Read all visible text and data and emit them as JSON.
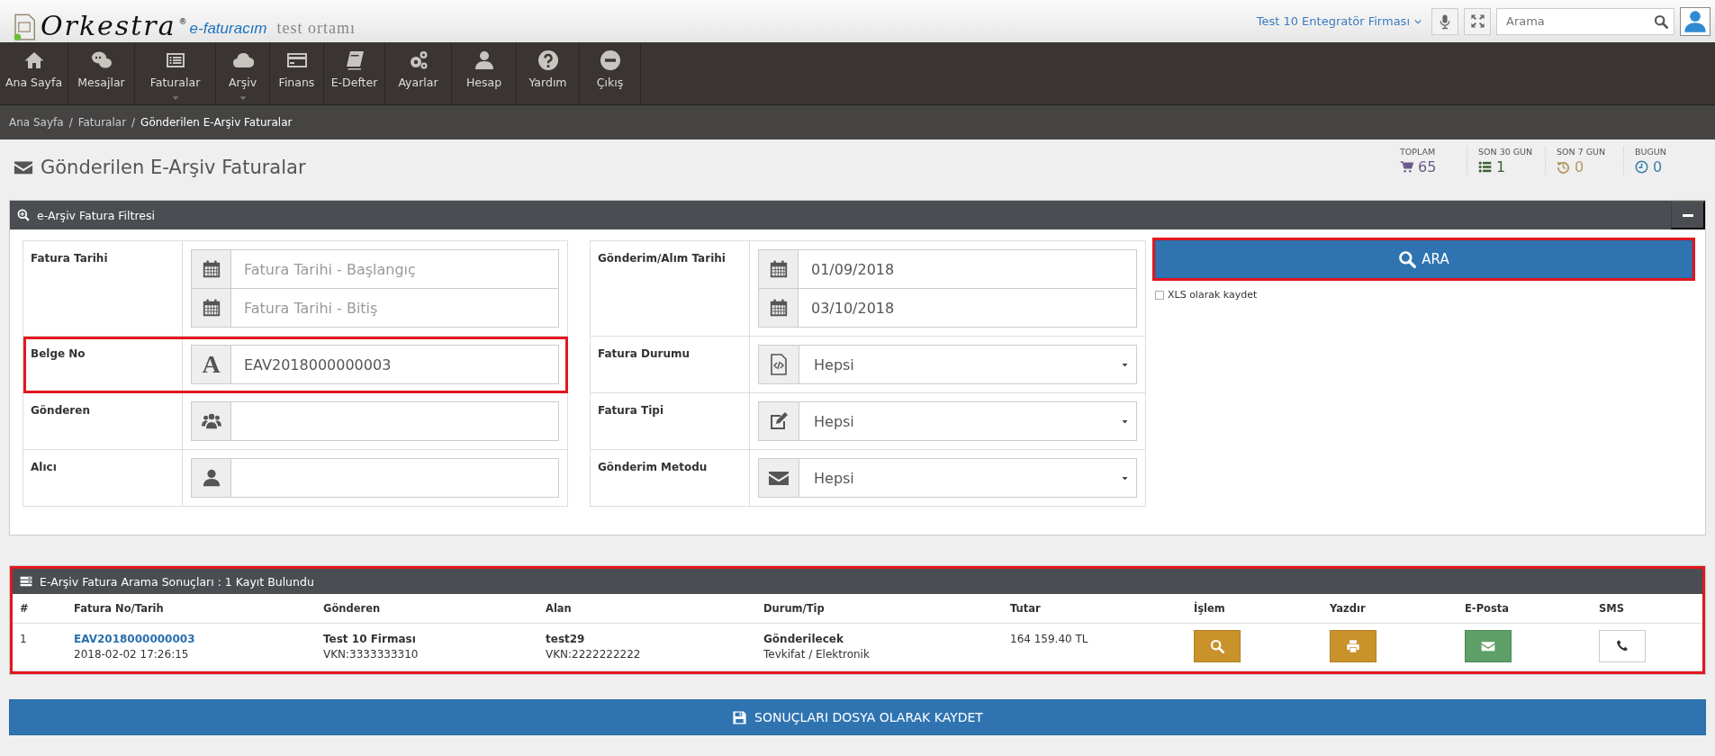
{
  "header": {
    "logo": {
      "brand": "Orkestra",
      "registered": "®",
      "product": "e-faturacım",
      "environment": "test ortamı"
    },
    "company": "Test 10 Entegratör Firması",
    "search": {
      "placeholder": "Arama"
    }
  },
  "nav": [
    {
      "label": "Ana Sayfa",
      "has_submenu": false
    },
    {
      "label": "Mesajlar",
      "has_submenu": false
    },
    {
      "label": "Faturalar",
      "has_submenu": true
    },
    {
      "label": "Arşiv",
      "has_submenu": true
    },
    {
      "label": "Finans",
      "has_submenu": false
    },
    {
      "label": "E-Defter",
      "has_submenu": false
    },
    {
      "label": "Ayarlar",
      "has_submenu": false
    },
    {
      "label": "Hesap",
      "has_submenu": false
    },
    {
      "label": "Yardım",
      "has_submenu": false
    },
    {
      "label": "Çıkış",
      "has_submenu": false
    }
  ],
  "breadcrumb": {
    "separator": "/",
    "items": [
      "Ana Sayfa",
      "Faturalar",
      "Gönderilen E-Arşiv Faturalar"
    ]
  },
  "page_title": "Gönderilen E-Arşiv Faturalar",
  "stats": [
    {
      "label": "TOPLAM",
      "value": "65",
      "color": "#6b5a88"
    },
    {
      "label": "SON 30 GUN",
      "value": "1",
      "color": "#3b5f32"
    },
    {
      "label": "SON 7 GUN",
      "value": "0",
      "color": "#b39a63"
    },
    {
      "label": "BUGUN",
      "value": "0",
      "color": "#3f80a8"
    }
  ],
  "filter": {
    "title": "e-Arşiv Fatura Filtresi",
    "left_rows": [
      {
        "label": "Fatura Tarihi",
        "highlighted": false,
        "fields": [
          {
            "kind": "input",
            "placeholder": "Fatura Tarihi - Başlangıç"
          },
          {
            "kind": "input",
            "placeholder": "Fatura Tarihi - Bitiş"
          }
        ]
      },
      {
        "label": "Belge No",
        "highlighted": true,
        "fields": [
          {
            "kind": "input",
            "icon_text": "A",
            "value": "EAV2018000000003"
          }
        ]
      },
      {
        "label": "Gönderen",
        "highlighted": false,
        "fields": [
          {
            "kind": "input"
          }
        ]
      },
      {
        "label": "Alıcı",
        "highlighted": false,
        "fields": [
          {
            "kind": "input"
          }
        ]
      }
    ],
    "right_rows": [
      {
        "label": "Gönderim/Alım Tarihi",
        "highlighted": false,
        "fields": [
          {
            "kind": "input",
            "value": "01/09/2018"
          },
          {
            "kind": "input",
            "value": "03/10/2018"
          }
        ]
      },
      {
        "label": "Fatura Durumu",
        "highlighted": false,
        "fields": [
          {
            "kind": "select",
            "value": "Hepsi"
          }
        ]
      },
      {
        "label": "Fatura Tipi",
        "highlighted": false,
        "fields": [
          {
            "kind": "select",
            "value": "Hepsi"
          }
        ]
      },
      {
        "label": "Gönderim Metodu",
        "highlighted": false,
        "fields": [
          {
            "kind": "select",
            "value": "Hepsi"
          }
        ]
      }
    ],
    "search_button": {
      "label": "ARA",
      "highlighted": true
    },
    "xls_checkbox": {
      "label": "XLS olarak kaydet",
      "checked": false
    }
  },
  "results": {
    "title": "E-Arşiv Fatura Arama Sonuçları : 1 Kayıt Bulundu",
    "highlighted": true,
    "columns": [
      "#",
      "Fatura No/Tarih",
      "Gönderen",
      "Alan",
      "Durum/Tip",
      "Tutar",
      "İşlem",
      "Yazdır",
      "E-Posta",
      "SMS"
    ],
    "rows": [
      {
        "index": "1",
        "invoice_no": "EAV2018000000003",
        "date": "2018-02-02 17:26:15",
        "sender": "Test 10 Firması",
        "sender_vkn": "VKN:3333333310",
        "receiver": "test29",
        "receiver_vkn": "VKN:2222222222",
        "status": "Gönderilecek",
        "type": "Tevkifat / Elektronik",
        "amount": "164 159.40 TL",
        "actions": [
          {
            "kind": "view"
          },
          {
            "kind": "print"
          },
          {
            "kind": "email"
          },
          {
            "kind": "sms"
          }
        ]
      }
    ]
  },
  "save_button": {
    "label": "SONUÇLARI DOSYA OLARAK KAYDET"
  }
}
